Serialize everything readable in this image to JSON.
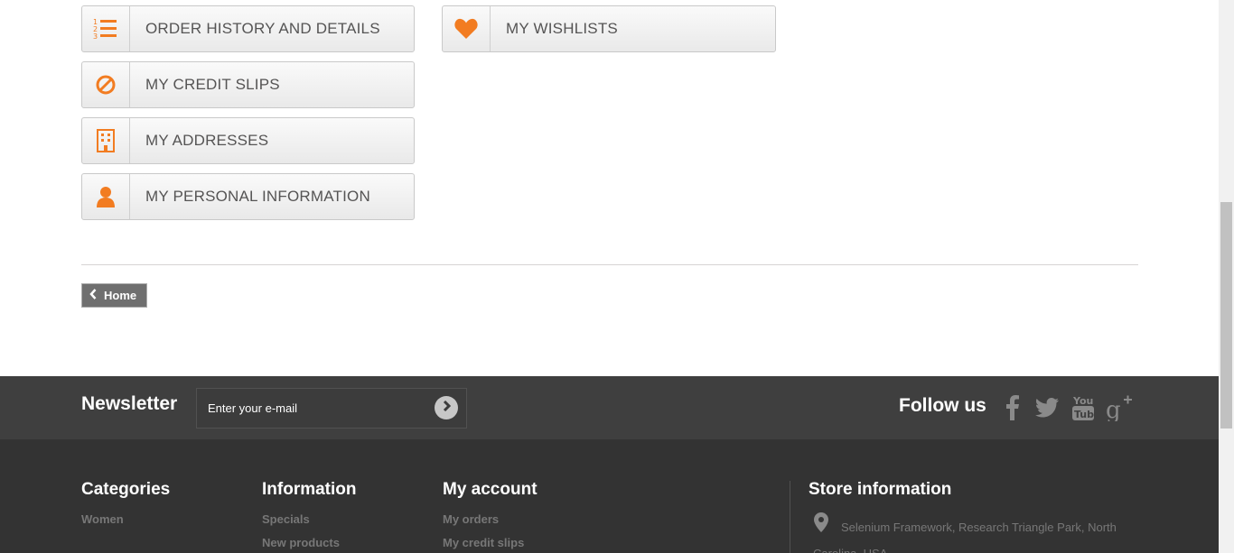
{
  "account_links": {
    "order_history": "ORDER HISTORY AND DETAILS",
    "credit_slips": "MY CREDIT SLIPS",
    "addresses": "MY ADDRESSES",
    "personal_info": "MY PERSONAL INFORMATION",
    "wishlists": "MY WISHLISTS"
  },
  "home_button": "Home",
  "newsletter": {
    "title": "Newsletter",
    "input_value": "Enter your e-mail"
  },
  "follow": {
    "title": "Follow us",
    "networks": [
      "facebook-icon",
      "twitter-icon",
      "youtube-icon",
      "google-plus-icon"
    ]
  },
  "footer": {
    "categories": {
      "title": "Categories",
      "items": [
        "Women"
      ]
    },
    "information": {
      "title": "Information",
      "items": [
        "Specials",
        "New products"
      ]
    },
    "my_account": {
      "title": "My account",
      "items": [
        "My orders",
        "My credit slips"
      ]
    },
    "store": {
      "title": "Store information",
      "address": "Selenium Framework, Research Triangle Park, North Carolina, USA"
    }
  },
  "colors": {
    "accent": "#f27c21",
    "footer_dark": "#333333",
    "newsletter_bar": "#3f3f3f"
  }
}
